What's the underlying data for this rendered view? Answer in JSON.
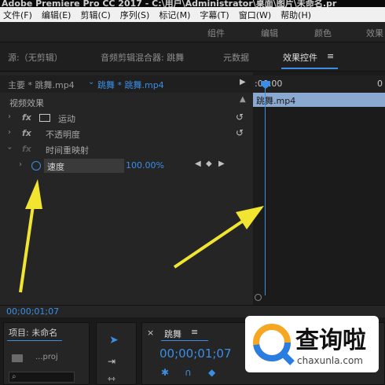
{
  "titlebar": {
    "text": "Adobe Premiere Pro CC 2017 - C:\\用户\\Administrator\\桌面\\图片\\未命名.pr"
  },
  "menu": [
    "文件(F)",
    "编辑(E)",
    "剪辑(C)",
    "序列(S)",
    "标记(M)",
    "字幕(T)",
    "窗口(W)",
    "帮助(H)"
  ],
  "workspaces": [
    "组件",
    "编辑",
    "颜色",
    "效果"
  ],
  "panel_tabs": {
    "source": "源:（无剪辑）",
    "audio_mixer": "音频剪辑混合器: 跳舞",
    "metadata": "元数据",
    "effect_controls": "效果控件",
    "menu_icon": "≡"
  },
  "effect_controls": {
    "master": "主要 * 跳舞.mp4",
    "clip": "跳舞 * 跳舞.mp4",
    "timecode_start": ":00:00",
    "video_effects": "视频效果",
    "effects": [
      {
        "label": "运动",
        "fx": "fx"
      },
      {
        "label": "不透明度",
        "fx": "fx"
      },
      {
        "label": "时间重映射",
        "fx": "fx"
      }
    ],
    "speed": {
      "label": "速度",
      "value": "100.00%"
    },
    "current_time": "00;00;01;07"
  },
  "timeline": {
    "clip_name": "跳舞.mp4"
  },
  "bottom": {
    "project_label": "项目: 未命名",
    "project_file": "...proj",
    "sequence_tab": "跳舞",
    "sequence_menu": "≡",
    "sequence_time": "00;00;01;07"
  },
  "watermark": {
    "text": "查询啦",
    "url": "chaxunla.com"
  },
  "colors": {
    "accent": "#3a8ee6",
    "arrow": "#f2e531",
    "clip": "#8aa8d0"
  }
}
